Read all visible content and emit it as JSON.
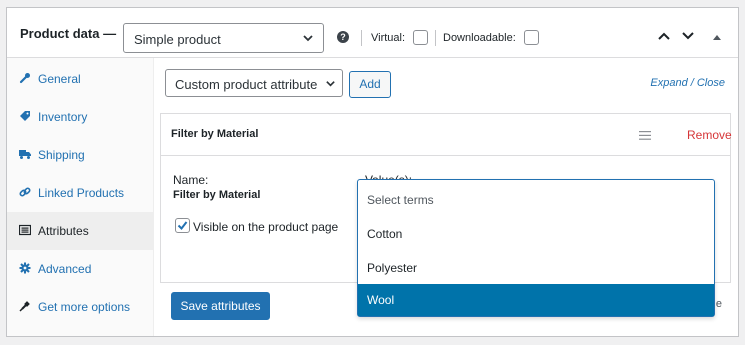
{
  "header": {
    "title": "Product data —",
    "product_type": "Simple product",
    "virtual_label": "Virtual:",
    "downloadable_label": "Downloadable:"
  },
  "sidebar": {
    "items": [
      {
        "label": "General",
        "icon": "wrench-icon"
      },
      {
        "label": "Inventory",
        "icon": "tag-icon"
      },
      {
        "label": "Shipping",
        "icon": "truck-icon"
      },
      {
        "label": "Linked Products",
        "icon": "link-icon"
      },
      {
        "label": "Attributes",
        "icon": "list-icon",
        "active": true
      },
      {
        "label": "Advanced",
        "icon": "gear-icon"
      },
      {
        "label": "Get more options",
        "icon": "plugin-icon"
      }
    ]
  },
  "main": {
    "attribute_select": "Custom product attribute",
    "add_label": "Add",
    "expand_close": "Expand / Close",
    "attribute": {
      "title": "Filter by Material",
      "remove_label": "Remove",
      "name_label": "Name:",
      "name_value": "Filter by Material",
      "visible_label": "Visible on the product page",
      "values_label": "Value(s):"
    },
    "save_label": "Save attributes",
    "save_trailing": "e"
  },
  "dropdown": {
    "placeholder": "Select terms",
    "options": [
      "Cotton",
      "Polyester",
      "Wool"
    ],
    "highlighted_index": 2
  },
  "colors": {
    "accent": "#2271b1",
    "highlight": "#0073aa",
    "remove": "#d63638"
  }
}
